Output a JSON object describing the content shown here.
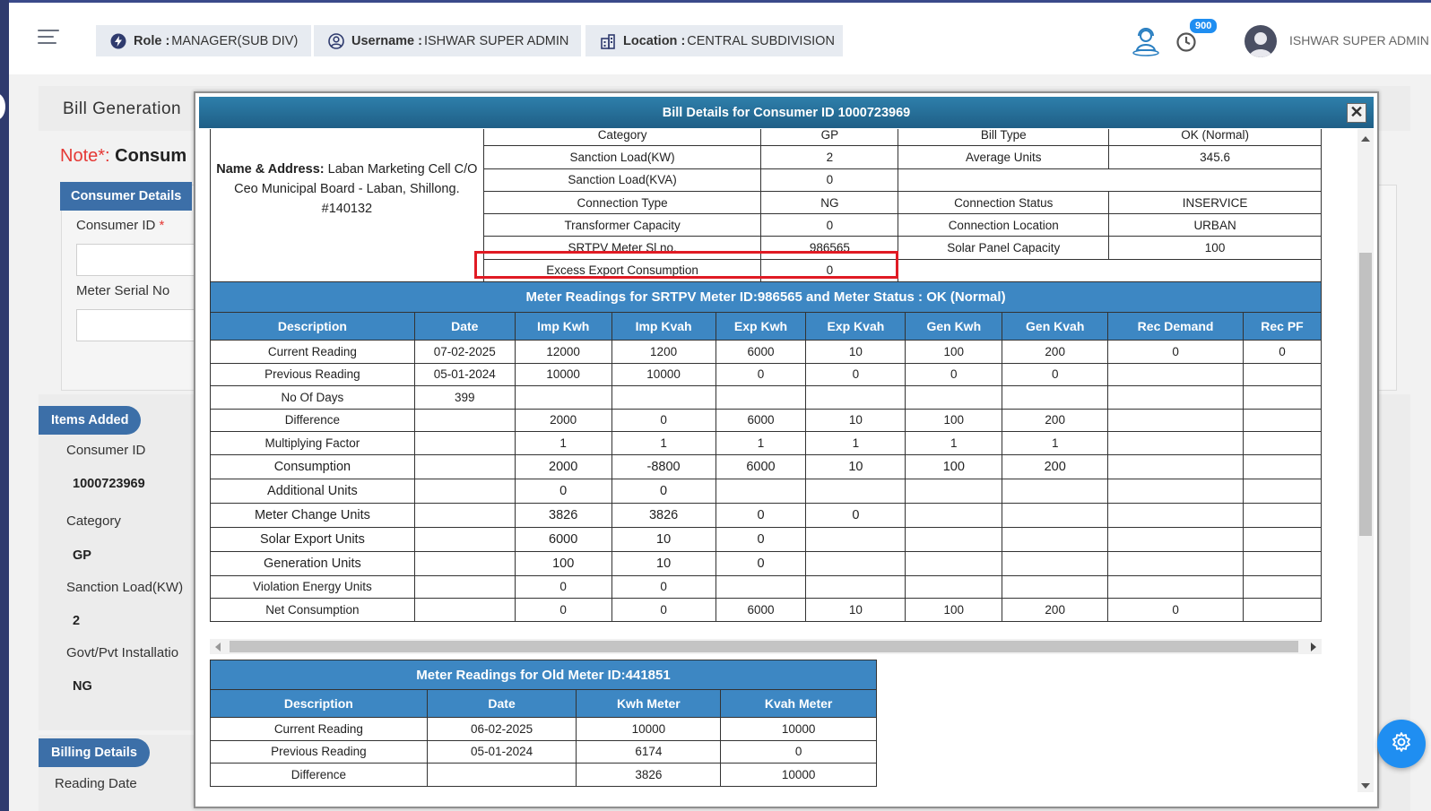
{
  "header": {
    "role_label": "Role :",
    "role_value": "MANAGER(SUB DIV)",
    "username_label": "Username :",
    "username_value": "ISHWAR SUPER ADMIN",
    "location_label": "Location :",
    "location_value": "CENTRAL SUBDIVISION",
    "notification_count": "900",
    "user_name": "ISHWAR SUPER ADMIN"
  },
  "background": {
    "page_title": "Bill Generation",
    "note_label": "Note*:",
    "note_text": "Consum",
    "consumer_details_head": "Consumer Details",
    "consumer_id_label": "Consumer ID",
    "consumer_id_required": "*",
    "meter_serial_label": "Meter Serial No",
    "items_added_head": "Items Added",
    "items": [
      {
        "label": "Consumer ID",
        "value": "1000723969"
      },
      {
        "label": "Category",
        "value": "GP"
      },
      {
        "label": "Sanction Load(KW)",
        "value": "2"
      },
      {
        "label": "Govt/Pvt Installatio",
        "value": "NG"
      }
    ],
    "billing_details_head": "Billing Details",
    "reading_date_label": "Reading Date"
  },
  "modal": {
    "title": "Bill Details for Consumer ID 1000723969",
    "close_symbol": "✕",
    "name_address_label": "Name & Address:",
    "name_address_value": "Laban Marketing Cell C/O Ceo Municipal Board - Laban, Shillong. #140132",
    "info_rows": [
      {
        "l1": "Category",
        "v1": "GP",
        "l2": "Bill Type",
        "v2": "OK (Normal)"
      },
      {
        "l1": "Sanction Load(KW)",
        "v1": "2",
        "l2": "Average Units",
        "v2": "345.6"
      },
      {
        "l1": "Sanction Load(KVA)",
        "v1": "0",
        "l2": "",
        "v2": ""
      },
      {
        "l1": "Connection Type",
        "v1": "NG",
        "l2": "Connection Status",
        "v2": "INSERVICE"
      },
      {
        "l1": "Transformer Capacity",
        "v1": "0",
        "l2": "Connection Location",
        "v2": "URBAN"
      },
      {
        "l1": "SRTPV Meter Sl no.",
        "v1": "986565",
        "l2": "Solar Panel Capacity",
        "v2": "100"
      },
      {
        "l1": "Excess Export Consumption",
        "v1": "0",
        "l2": "",
        "v2": ""
      }
    ],
    "srtpv": {
      "caption": "Meter Readings for SRTPV Meter ID:986565 and Meter Status : OK (Normal)",
      "headers": [
        "Description",
        "Date",
        "Imp Kwh",
        "Imp Kvah",
        "Exp Kwh",
        "Exp Kvah",
        "Gen Kwh",
        "Gen Kvah",
        "Rec Demand",
        "Rec PF"
      ],
      "rows": [
        [
          "Current Reading",
          "07-02-2025",
          "12000",
          "1200",
          "6000",
          "10",
          "100",
          "200",
          "0",
          "0"
        ],
        [
          "Previous Reading",
          "05-01-2024",
          "10000",
          "10000",
          "0",
          "0",
          "0",
          "0",
          "",
          ""
        ],
        [
          "No Of Days",
          "399",
          "",
          "",
          "",
          "",
          "",
          "",
          "",
          ""
        ],
        [
          "Difference",
          "",
          "2000",
          "0",
          "6000",
          "10",
          "100",
          "200",
          "",
          ""
        ],
        [
          "Multiplying Factor",
          "",
          "1",
          "1",
          "1",
          "1",
          "1",
          "1",
          "",
          ""
        ],
        [
          "Consumption",
          "",
          "2000",
          "-8800",
          "6000",
          "10",
          "100",
          "200",
          "",
          ""
        ],
        [
          "Additional Units",
          "",
          "0",
          "0",
          "",
          "",
          "",
          "",
          "",
          ""
        ],
        [
          "Meter Change Units",
          "",
          "3826",
          "3826",
          "0",
          "0",
          "",
          "",
          "",
          ""
        ],
        [
          "Solar Export Units",
          "",
          "6000",
          "10",
          "0",
          "",
          "",
          "",
          "",
          ""
        ],
        [
          "Generation Units",
          "",
          "100",
          "10",
          "0",
          "",
          "",
          "",
          "",
          ""
        ],
        [
          "Violation Energy Units",
          "",
          "0",
          "0",
          "",
          "",
          "",
          "",
          "",
          ""
        ],
        [
          "Net Consumption",
          "",
          "0",
          "0",
          "6000",
          "10",
          "100",
          "200",
          "0",
          ""
        ]
      ]
    },
    "old_meter": {
      "caption": "Meter Readings for Old Meter ID:441851",
      "headers": [
        "Description",
        "Date",
        "Kwh Meter",
        "Kvah Meter"
      ],
      "rows": [
        [
          "Current Reading",
          "06-02-2025",
          "10000",
          "10000"
        ],
        [
          "Previous Reading",
          "05-01-2024",
          "6174",
          "0"
        ],
        [
          "Difference",
          "",
          "3826",
          "10000"
        ]
      ]
    }
  },
  "icons": {
    "menu": "hamburger-icon",
    "role": "lightning-icon",
    "user": "user-circle-icon",
    "location": "building-icon",
    "support": "support-agent-icon",
    "clock": "clock-icon",
    "settings": "gear-icon"
  },
  "colors": {
    "brand_blue": "#3d87c3",
    "modal_title": "#1f5f86",
    "highlight": "#e01b24",
    "badge": "#1f8ef1"
  }
}
